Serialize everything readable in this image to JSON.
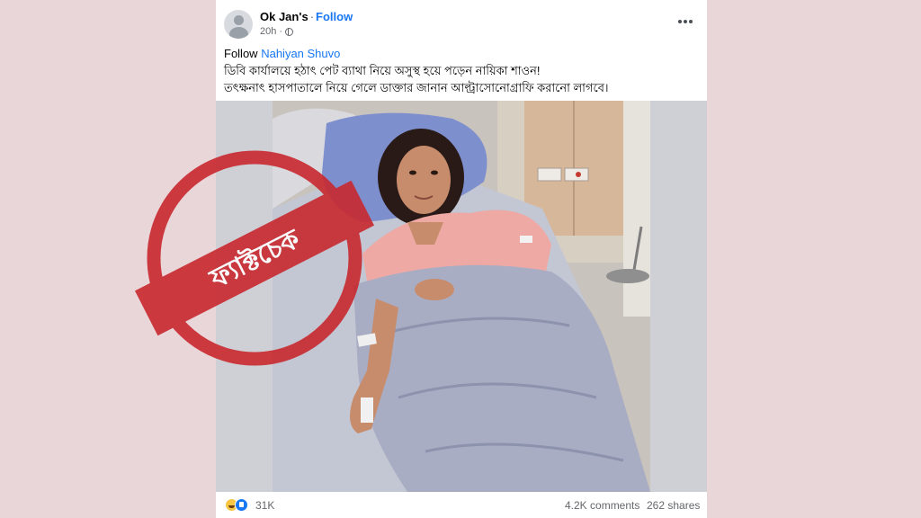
{
  "post": {
    "author": "Ok Jan's",
    "follow_label": "Follow",
    "time": "20h",
    "text_prefix": "Follow",
    "mention": "Nahiyan Shuvo",
    "line1": "ডিবি কার্যালয়ে হঠাৎ পেট ব্যাথা নিয়ে অসুস্থ হয়ে পড়েন নায়িকা শাওন!",
    "line2": "তৎক্ষনাৎ হাসপাতালে নিয়ে গেলে ডাক্তার জানান আল্ট্রাসোনোগ্রাফি করানো লাগবে।"
  },
  "stats": {
    "reaction_count": "31K",
    "comments": "4.2K comments",
    "shares": "262 shares"
  },
  "stamp": {
    "text": "ফ্যাক্টচেক",
    "color": "#c8282e"
  },
  "icons": {
    "avatar": "default-avatar",
    "privacy": "globe-icon",
    "more": "ellipsis-icon",
    "reactions": [
      "haha-icon",
      "like-icon"
    ]
  }
}
